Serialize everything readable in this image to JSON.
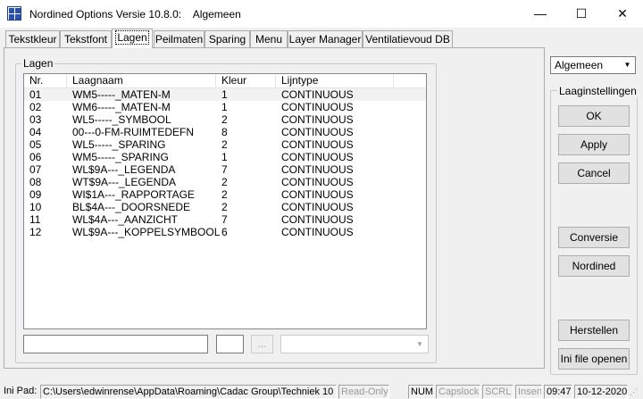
{
  "window": {
    "title": "Nordined Options Versie 10.8.0:    Algemeen",
    "minimize": "—",
    "maximize": "☐",
    "close": "✕"
  },
  "tabs": [
    {
      "label": "Tekstkleur"
    },
    {
      "label": "Tekstfont"
    },
    {
      "label": "Lagen"
    },
    {
      "label": "Peilmaten"
    },
    {
      "label": "Sparing"
    },
    {
      "label": "Menu"
    },
    {
      "label": "Layer Manager"
    },
    {
      "label": "Ventilatievoud DB"
    }
  ],
  "active_tab": "Lagen",
  "layers": {
    "group_label": "Lagen",
    "columns": [
      "Nr.",
      "Laagnaam",
      "Kleur",
      "Lijntype"
    ],
    "rows": [
      [
        "01",
        "WM5-----_MATEN-M",
        "1",
        "CONTINUOUS"
      ],
      [
        "02",
        "WM6-----_MATEN-M",
        "1",
        "CONTINUOUS"
      ],
      [
        "03",
        "WL5-----_SYMBOOL",
        "2",
        "CONTINUOUS"
      ],
      [
        "04",
        "00---0-FM-RUIMTEDEFN",
        "8",
        "CONTINUOUS"
      ],
      [
        "05",
        "WL5-----_SPARING",
        "2",
        "CONTINUOUS"
      ],
      [
        "06",
        "WM5-----_SPARING",
        "1",
        "CONTINUOUS"
      ],
      [
        "07",
        "WL$9A---_LEGENDA",
        "7",
        "CONTINUOUS"
      ],
      [
        "08",
        "WT$9A---_LEGENDA",
        "2",
        "CONTINUOUS"
      ],
      [
        "09",
        "WI$1A---_RAPPORTAGE",
        "2",
        "CONTINUOUS"
      ],
      [
        "10",
        "BL$4A---_DOORSNEDE",
        "2",
        "CONTINUOUS"
      ],
      [
        "11",
        "WL$4A---_AANZICHT",
        "7",
        "CONTINUOUS"
      ],
      [
        "12",
        "WL$9A---_KOPPELSYMBOOL",
        "6",
        "CONTINUOUS"
      ]
    ],
    "name_value": "",
    "color_value": "",
    "browse_label": "...",
    "linetype_value": ""
  },
  "right_panel": {
    "profile": "Algemeen",
    "group_label": "Laaginstellingen",
    "ok": "OK",
    "apply": "Apply",
    "cancel": "Cancel",
    "conversie": "Conversie",
    "nordined": "Nordined",
    "herstellen": "Herstellen",
    "ini_open": "Ini file openen"
  },
  "statusbar": {
    "ini_label": "Ini Pad:",
    "ini_path": "C:\\Users\\edwinrense\\AppData\\Roaming\\Cadac Group\\Techniek 10",
    "readonly": "Read-Only",
    "num": "NUM",
    "capslock": "Capslock",
    "scrl": "SCRL",
    "insert": "Insert",
    "time": "09:47",
    "date": "10-12-2020"
  }
}
